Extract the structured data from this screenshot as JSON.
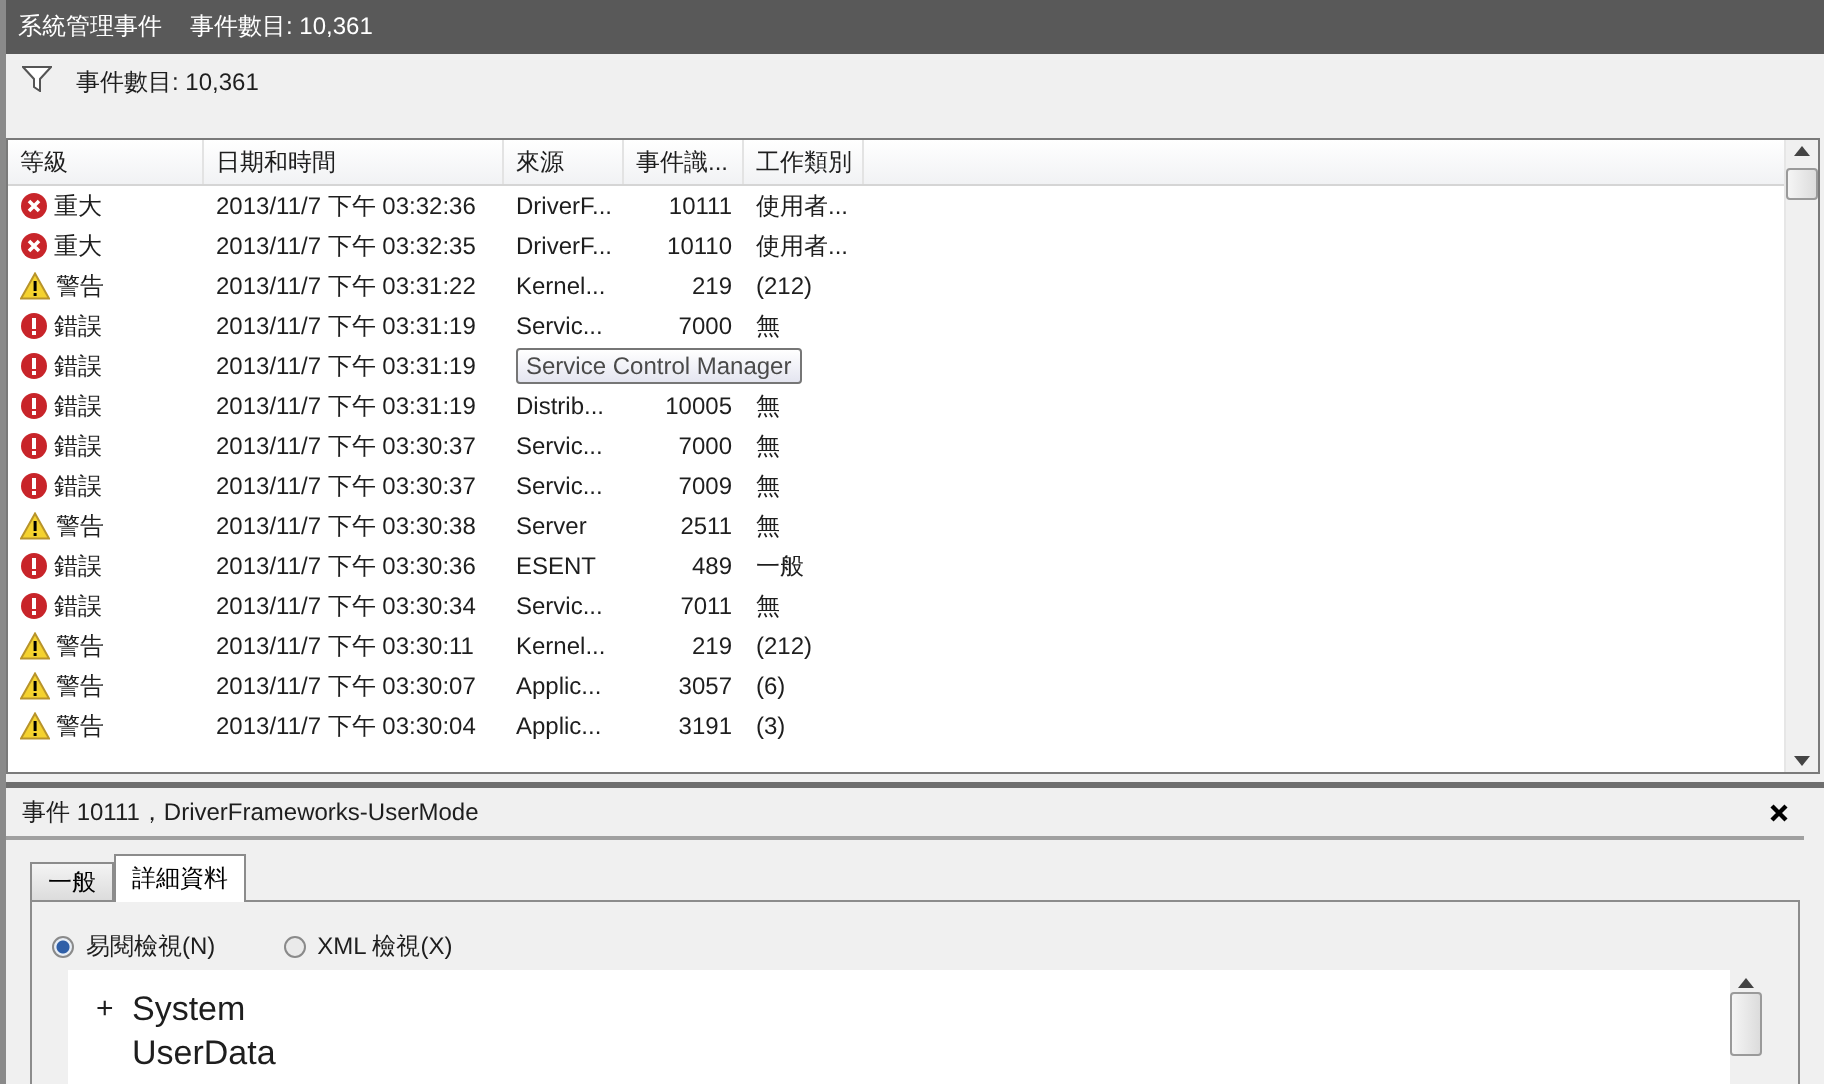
{
  "window": {
    "title": "系統管理事件",
    "count": "事件數目: 10,361"
  },
  "filter": {
    "label": "事件數目: 10,361"
  },
  "table": {
    "columns": [
      "等級",
      "日期和時間",
      "來源",
      "事件識...",
      "工作類別"
    ],
    "rows": [
      {
        "kind": "critical",
        "level": "重大",
        "datetime": "2013/11/7 下午 03:32:36",
        "source": "DriverF...",
        "id": "10111",
        "category": "使用者..."
      },
      {
        "kind": "critical",
        "level": "重大",
        "datetime": "2013/11/7 下午 03:32:35",
        "source": "DriverF...",
        "id": "10110",
        "category": "使用者..."
      },
      {
        "kind": "warning",
        "level": "警告",
        "datetime": "2013/11/7 下午 03:31:22",
        "source": "Kernel...",
        "id": "219",
        "category": "(212)"
      },
      {
        "kind": "error",
        "level": "錯誤",
        "datetime": "2013/11/7 下午 03:31:19",
        "source": "Servic...",
        "id": "7000",
        "category": "無"
      },
      {
        "kind": "error",
        "level": "錯誤",
        "datetime": "2013/11/7 下午 03:31:19",
        "tooltip": "Service Control Manager"
      },
      {
        "kind": "error",
        "level": "錯誤",
        "datetime": "2013/11/7 下午 03:31:19",
        "source": "Distrib...",
        "id": "10005",
        "category": "無"
      },
      {
        "kind": "error",
        "level": "錯誤",
        "datetime": "2013/11/7 下午 03:30:37",
        "source": "Servic...",
        "id": "7000",
        "category": "無"
      },
      {
        "kind": "error",
        "level": "錯誤",
        "datetime": "2013/11/7 下午 03:30:37",
        "source": "Servic...",
        "id": "7009",
        "category": "無"
      },
      {
        "kind": "warning",
        "level": "警告",
        "datetime": "2013/11/7 下午 03:30:38",
        "source": "Server",
        "id": "2511",
        "category": "無"
      },
      {
        "kind": "error",
        "level": "錯誤",
        "datetime": "2013/11/7 下午 03:30:36",
        "source": "ESENT",
        "id": "489",
        "category": "一般"
      },
      {
        "kind": "error",
        "level": "錯誤",
        "datetime": "2013/11/7 下午 03:30:34",
        "source": "Servic...",
        "id": "7011",
        "category": "無"
      },
      {
        "kind": "warning",
        "level": "警告",
        "datetime": "2013/11/7 下午 03:30:11",
        "source": "Kernel...",
        "id": "219",
        "category": "(212)"
      },
      {
        "kind": "warning",
        "level": "警告",
        "datetime": "2013/11/7 下午 03:30:07",
        "source": "Applic...",
        "id": "3057",
        "category": "(6)"
      },
      {
        "kind": "warning",
        "level": "警告",
        "datetime": "2013/11/7 下午 03:30:04",
        "source": "Applic...",
        "id": "3191",
        "category": "(3)"
      }
    ]
  },
  "detail": {
    "title": "事件 10111，DriverFrameworks-UserMode",
    "tabs": [
      {
        "label": "一般",
        "selected": false
      },
      {
        "label": "詳細資料",
        "selected": true
      }
    ],
    "views": [
      {
        "label": "易閱檢視(N)",
        "selected": true
      },
      {
        "label": "XML 檢視(X)",
        "selected": false
      }
    ],
    "tree": [
      {
        "toggle": "+",
        "label": "System"
      },
      {
        "label": "UserData"
      }
    ]
  }
}
